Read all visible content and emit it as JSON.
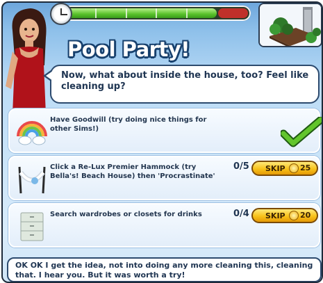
{
  "quest": {
    "title": "Pool Party!",
    "dialog": "Now, what about inside the house, too? Feel like cleaning up?",
    "progress": {
      "completed_fraction": 0.83,
      "segments": 5
    }
  },
  "tasks": [
    {
      "icon": "goodwill-rainbow-icon",
      "text": "Have Goodwill (try doing nice things for other Sims!)",
      "status": "complete"
    },
    {
      "icon": "hammock-icon",
      "text": "Click a Re-Lux Premier Hammock (try Bella's! Beach House) then 'Procrastinate'",
      "count": "0/5",
      "skip_label": "SKIP",
      "skip_cost": "25"
    },
    {
      "icon": "wardrobe-icon",
      "text": "Search wardrobes or closets for drinks",
      "count": "0/4",
      "skip_label": "SKIP",
      "skip_cost": "20"
    }
  ],
  "footer": {
    "text": "OK OK I get the idea, not into doing any more cleaning this, cleaning that. I hear you. But it was worth a try!"
  },
  "colors": {
    "accent_green": "#58c02a",
    "skip_gold": "#f8c21a",
    "title_outline": "#17406d"
  }
}
